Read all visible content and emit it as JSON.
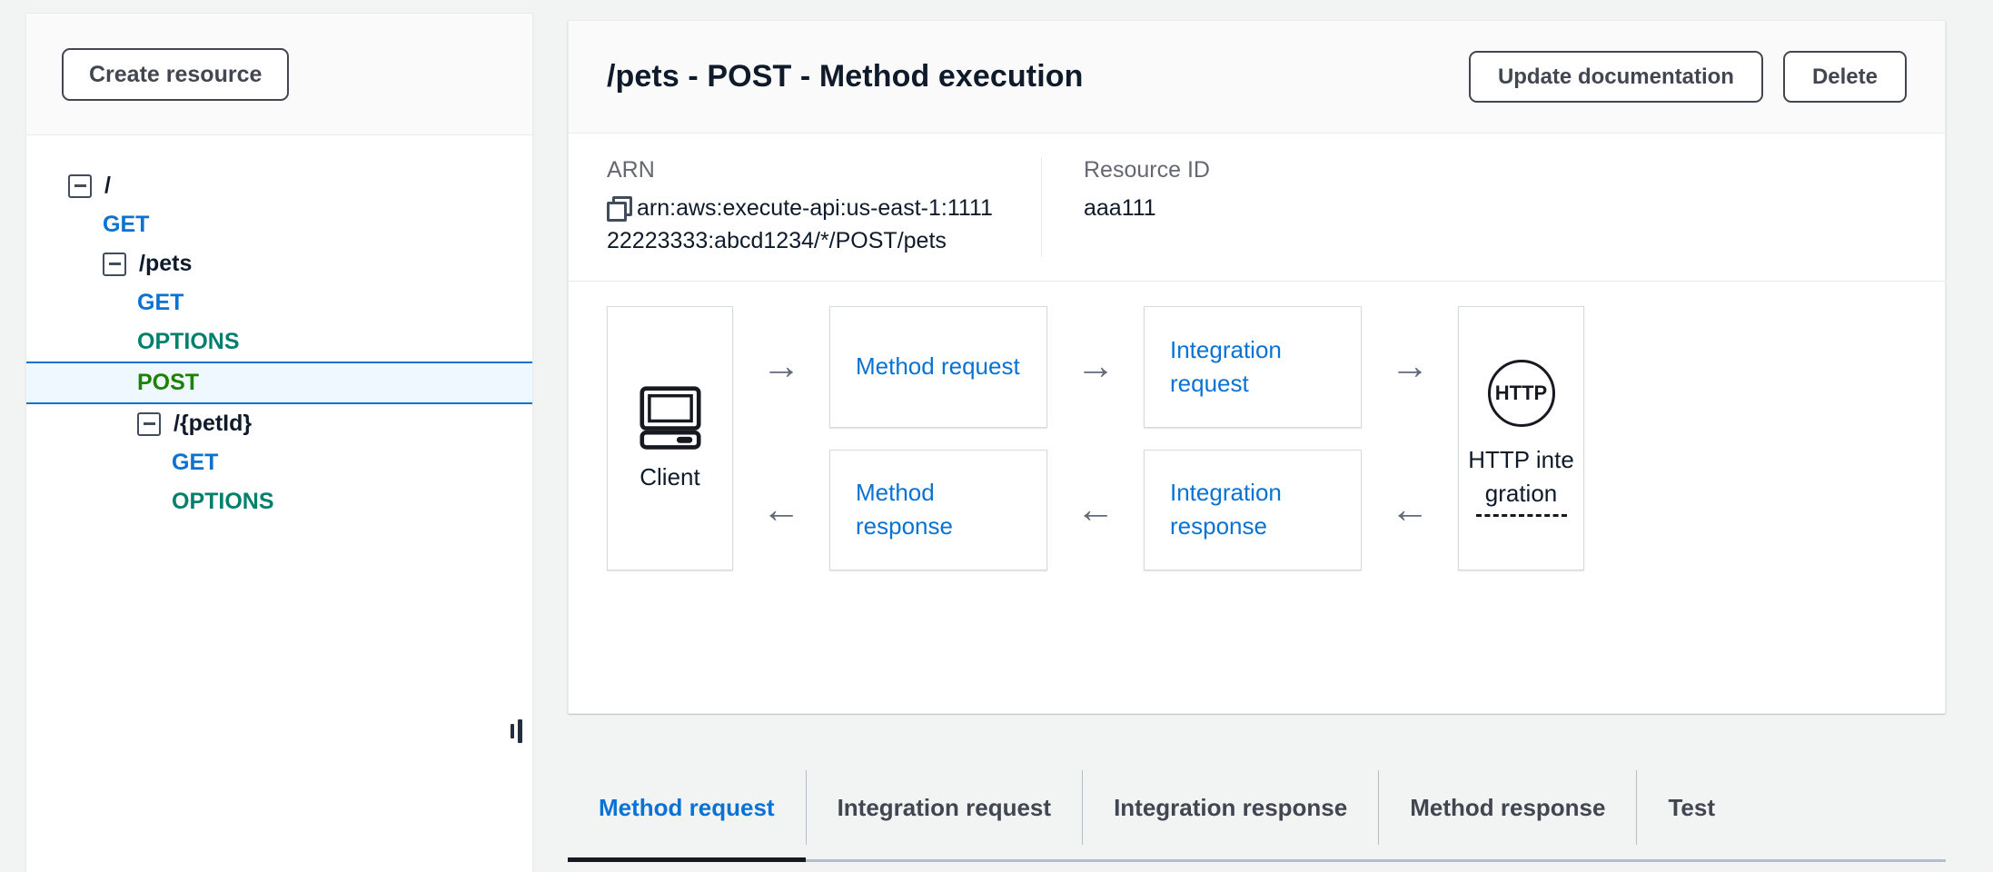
{
  "sidebar": {
    "create_resource_label": "Create resource",
    "tree": [
      {
        "type": "resource",
        "label": "/",
        "depth": 0,
        "expandable": true,
        "selected": false
      },
      {
        "type": "method",
        "label": "GET",
        "depth": 1,
        "expandable": false,
        "selected": false,
        "method": "GET"
      },
      {
        "type": "resource",
        "label": "/pets",
        "depth": 1,
        "expandable": true,
        "selected": false
      },
      {
        "type": "method",
        "label": "GET",
        "depth": 2,
        "expandable": false,
        "selected": false,
        "method": "GET"
      },
      {
        "type": "method",
        "label": "OPTIONS",
        "depth": 2,
        "expandable": false,
        "selected": false,
        "method": "OPTIONS"
      },
      {
        "type": "method",
        "label": "POST",
        "depth": 2,
        "expandable": false,
        "selected": true,
        "method": "POST"
      },
      {
        "type": "resource",
        "label": "/{petId}",
        "depth": 2,
        "expandable": true,
        "selected": false
      },
      {
        "type": "method",
        "label": "GET",
        "depth": 3,
        "expandable": false,
        "selected": false,
        "method": "GET"
      },
      {
        "type": "method",
        "label": "OPTIONS",
        "depth": 3,
        "expandable": false,
        "selected": false,
        "method": "OPTIONS"
      }
    ]
  },
  "main": {
    "title": "/pets - POST - Method execution",
    "actions": {
      "update_documentation_label": "Update documentation",
      "delete_label": "Delete"
    },
    "info": {
      "arn_label": "ARN",
      "arn_value": "arn:aws:execute-api:us-east-1:111122223333:abcd1234/*/POST/pets",
      "resource_id_label": "Resource ID",
      "resource_id_value": "aaa111"
    },
    "flow": {
      "client_label": "Client",
      "method_request_label": "Method request",
      "integration_request_label": "Integration request",
      "method_response_label": "Method response",
      "integration_response_label": "Integration response",
      "http_badge_label": "HTTP",
      "http_integration_label": "HTTP integration",
      "arrow_right": "→",
      "arrow_left": "←"
    }
  },
  "tabs": [
    {
      "label": "Method request",
      "active": true
    },
    {
      "label": "Integration request",
      "active": false
    },
    {
      "label": "Integration response",
      "active": false
    },
    {
      "label": "Method response",
      "active": false
    },
    {
      "label": "Test",
      "active": false
    }
  ],
  "colors": {
    "method_get": "#0972d3",
    "method_options": "#037f6e",
    "method_post": "#1d8102",
    "link": "#0972d3",
    "selected_bg": "#f0f8ff",
    "selected_border": "#0972d3",
    "page_bg": "#f2f3f3"
  }
}
